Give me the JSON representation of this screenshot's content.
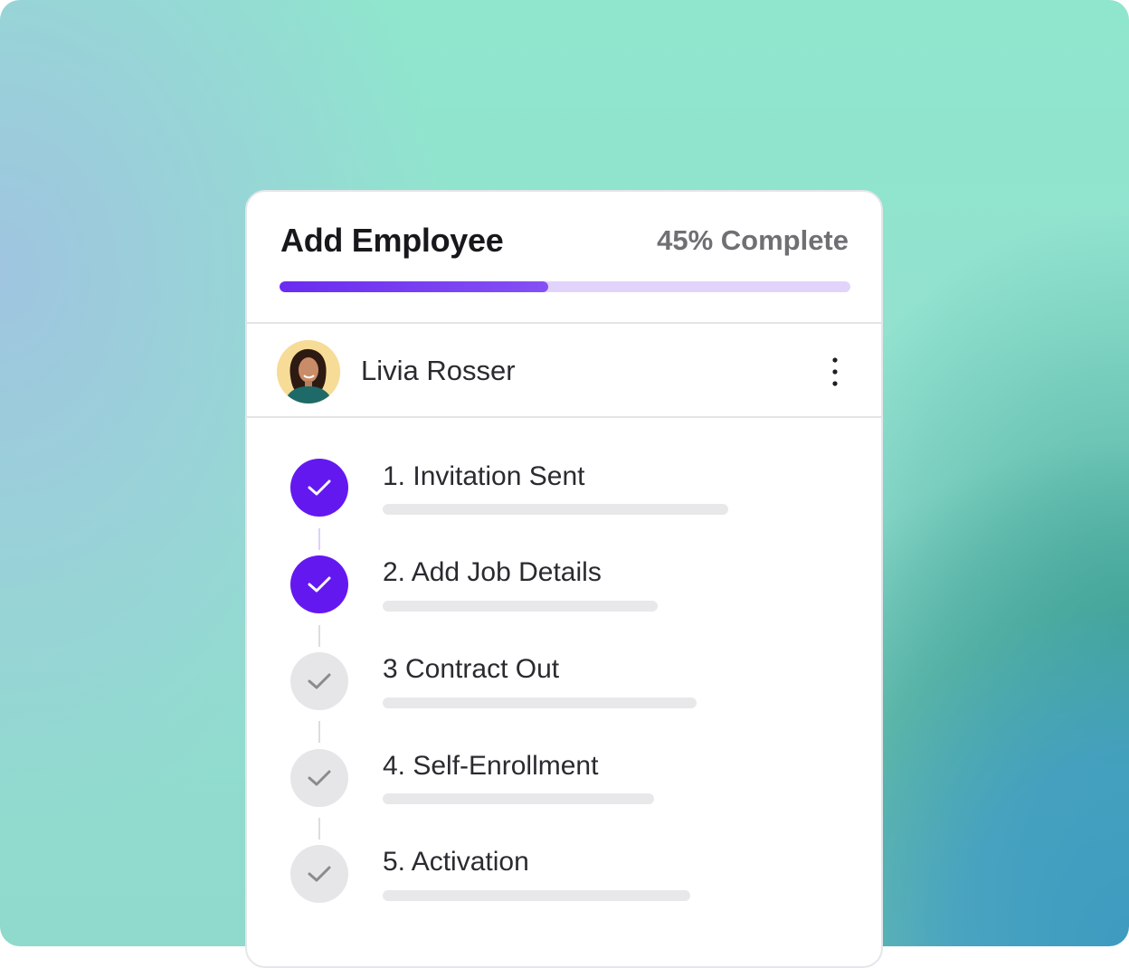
{
  "card": {
    "title": "Add Employee",
    "progress_label": "45% Complete",
    "progress_value": 0.47,
    "accent_color": "#6418f0",
    "track_color": "#e2d3fb"
  },
  "employee": {
    "name": "Livia Rosser",
    "more_icon": "vertical-ellipsis-icon"
  },
  "steps": [
    {
      "label": "1. Invitation Sent",
      "status": "complete"
    },
    {
      "label": "2. Add Job Details",
      "status": "complete"
    },
    {
      "label": "3 Contract Out",
      "status": "pending"
    },
    {
      "label": "4. Self-Enrollment",
      "status": "pending"
    },
    {
      "label": "5. Activation",
      "status": "pending"
    }
  ],
  "colors": {
    "complete": "#6418f0",
    "pending": "#e6e6e8",
    "check_complete": "#ffffff",
    "check_pending": "#8a8a8f"
  }
}
